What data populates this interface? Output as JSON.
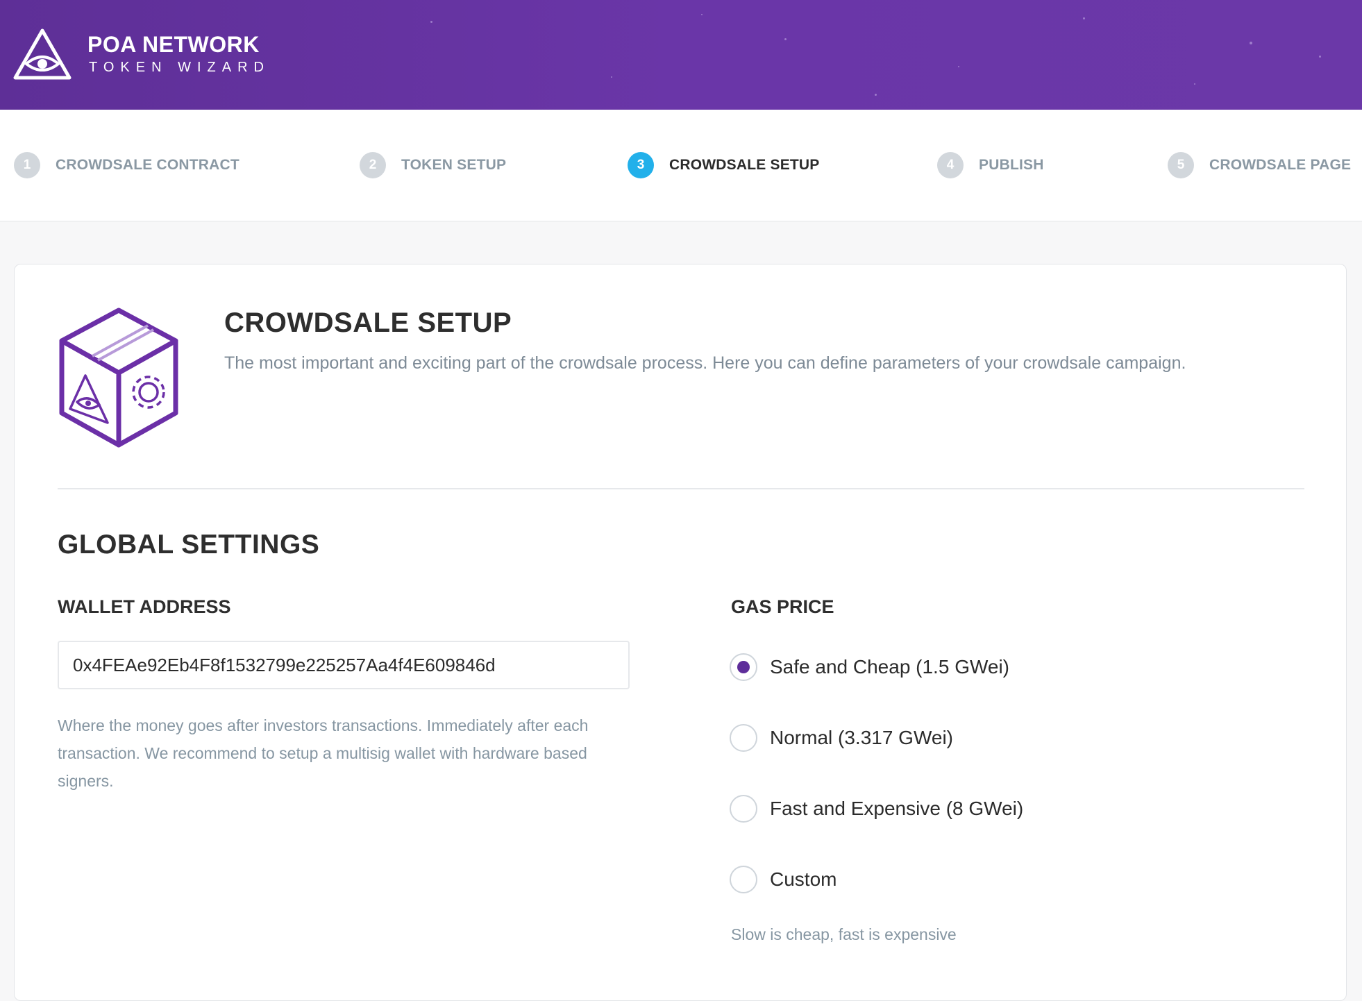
{
  "header": {
    "brand_title": "POA NETWORK",
    "brand_subtitle": "TOKEN WIZARD",
    "logo_icon": "eye-triangle-icon"
  },
  "steps": [
    {
      "number": "1",
      "label": "CROWDSALE CONTRACT",
      "active": false
    },
    {
      "number": "2",
      "label": "TOKEN SETUP",
      "active": false
    },
    {
      "number": "3",
      "label": "CROWDSALE SETUP",
      "active": true
    },
    {
      "number": "4",
      "label": "PUBLISH",
      "active": false
    },
    {
      "number": "5",
      "label": "CROWDSALE PAGE",
      "active": false
    }
  ],
  "page": {
    "icon": "crowdsale-box-icon",
    "title": "CROWDSALE SETUP",
    "description": "The most important and exciting part of the crowdsale process. Here you can define parameters of your crowdsale campaign."
  },
  "global_settings": {
    "title": "GLOBAL SETTINGS",
    "wallet": {
      "label": "WALLET ADDRESS",
      "value": "0x4FEAe92Eb4F8f1532799e225257Aa4f4E609846d",
      "help": "Where the money goes after investors transactions. Immediately after each transaction. We recommend to setup a multisig wallet with hardware based signers."
    },
    "gas_price": {
      "label": "GAS PRICE",
      "options": [
        {
          "label": "Safe and Cheap (1.5 GWei)",
          "checked": true
        },
        {
          "label": "Normal (3.317 GWei)",
          "checked": false
        },
        {
          "label": "Fast and Expensive (8 GWei)",
          "checked": false
        },
        {
          "label": "Custom",
          "checked": false
        }
      ],
      "help": "Slow is cheap, fast is expensive"
    }
  },
  "colors": {
    "brand_purple": "#6a36a8",
    "active_step": "#22b0ea",
    "inactive_step": "#d2d7dc",
    "muted_text": "#7d8a96"
  }
}
